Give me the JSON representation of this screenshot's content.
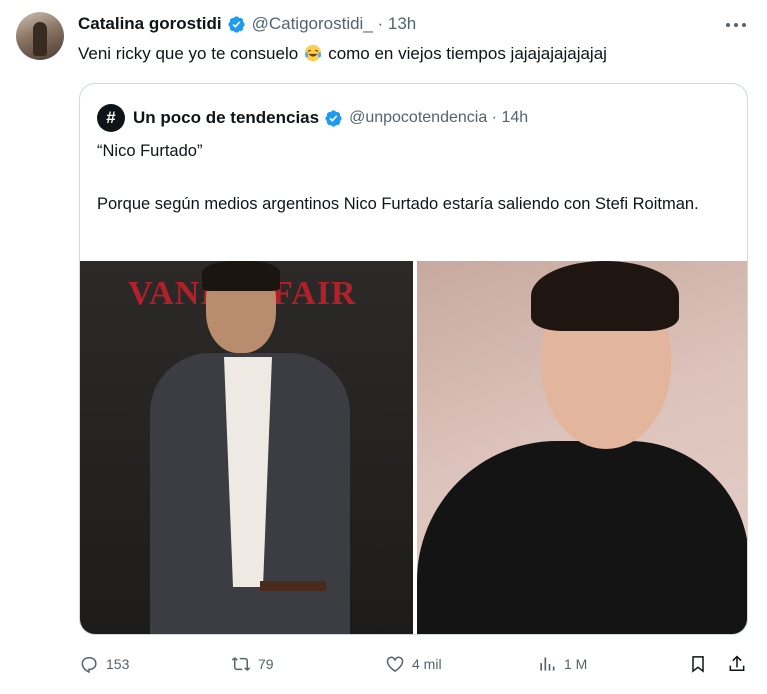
{
  "tweet": {
    "author_name": "Catalina gorostidi",
    "handle_time": "@Catigorostidi_ · 13h",
    "text_before": "Veni ricky que yo te consuelo",
    "text_after": "como en viejos tiempos jajajajajajajaj",
    "emoji": "crying-laughing-emoji"
  },
  "quote": {
    "avatar_glyph": "#",
    "author_name": "Un poco de tendencias",
    "handle_time": "@unpocotendencia · 14h",
    "line1": "“Nico Furtado”",
    "line2": "Porque según medios argentinos Nico Furtado estaría saliendo con Stefi Roitman.",
    "photo_left_sign": "VANITY FAIR"
  },
  "actions": {
    "replies": "153",
    "retweets": "79",
    "likes": "4 mil",
    "views": "1 M"
  },
  "colors": {
    "verified": "#1d9bf0",
    "secondary_text": "#536471",
    "border": "#cfd9de"
  }
}
